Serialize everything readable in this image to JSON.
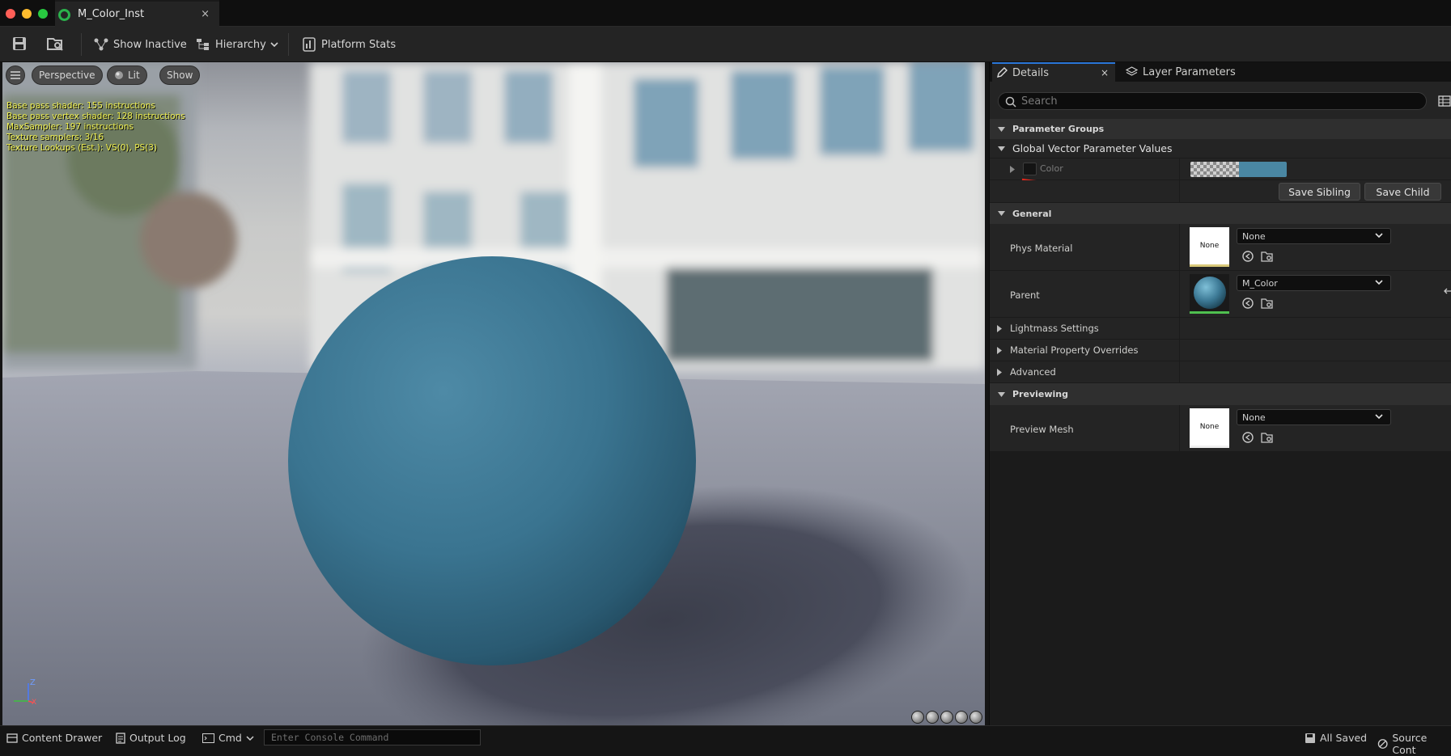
{
  "window": {
    "tab_title": "M_Color_Inst",
    "tab_close": "×"
  },
  "toolbar": {
    "show_inactive": "Show Inactive",
    "hierarchy": "Hierarchy",
    "platform_stats": "Platform Stats"
  },
  "viewport": {
    "perspective": "Perspective",
    "lit": "Lit",
    "show": "Show",
    "stats": [
      "Base pass shader: 155 instructions",
      "Base pass vertex shader: 128 instructions",
      "MaxSampler: 197 instructions",
      "Texture samplers: 3/16",
      "Texture Lookups (Est.): VS(0), PS(3)"
    ],
    "axis_z": "Z",
    "axis_x": "X"
  },
  "details": {
    "tab_details": "Details",
    "tab_close": "×",
    "tab_layer_parameters": "Layer Parameters",
    "search_placeholder": "Search",
    "categories": {
      "parameter_groups": "Parameter Groups",
      "global_vector": "Global Vector Parameter Values",
      "general": "General",
      "lightmass": "Lightmass Settings",
      "material_overrides": "Material Property Overrides",
      "advanced": "Advanced",
      "previewing": "Previewing"
    },
    "color_param": {
      "name": "Color",
      "color_value": "#4a87a3"
    },
    "save_sibling": "Save Sibling",
    "save_child": "Save Child",
    "phys_material": {
      "label": "Phys Material",
      "thumb": "None",
      "value": "None"
    },
    "parent": {
      "label": "Parent",
      "value": "M_Color"
    },
    "preview_mesh": {
      "label": "Preview Mesh",
      "thumb": "None",
      "value": "None"
    }
  },
  "statusbar": {
    "content_drawer": "Content Drawer",
    "output_log": "Output Log",
    "cmd": "Cmd",
    "console_placeholder": "Enter Console Command",
    "all_saved": "All Saved",
    "source_control": "Source Cont"
  },
  "colors": {
    "accent": "#2a76d8",
    "sphere": "#3d7893",
    "stats_text": "#f2f250"
  }
}
